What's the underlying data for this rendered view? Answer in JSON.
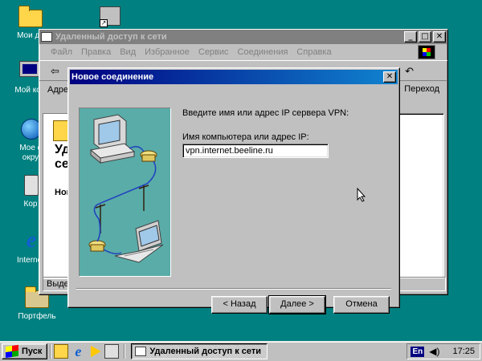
{
  "desktop": {
    "icons": [
      {
        "label": "Мои до",
        "icon": "folder-icon"
      },
      {
        "label": "Мой ком",
        "icon": "computer-icon"
      },
      {
        "label": "Мое с",
        "label2": "окру",
        "icon": "network-icon"
      },
      {
        "label": "Кор",
        "icon": "recycle-bin-icon"
      },
      {
        "label": "Internet",
        "icon": "internet-explorer-icon"
      },
      {
        "label": "Портфель",
        "icon": "briefcase-icon"
      }
    ]
  },
  "explorer": {
    "title": "Удаленный доступ к сети",
    "menu": [
      "Файл",
      "Правка",
      "Вид",
      "Избранное",
      "Сервис",
      "Соединения",
      "Справка"
    ],
    "address_label": "Адре",
    "go_label": "Переход",
    "heading_line1": "Уд",
    "heading_line2": "сет",
    "sub_label": "Нов",
    "status_text": "Выдел"
  },
  "dialog": {
    "title": "Новое соединение",
    "prompt": "Введите имя или адрес IP сервера VPN:",
    "field_label": "Имя компьютера или адрес IP:",
    "field_value": "vpn.internet.beeline.ru",
    "buttons": {
      "back": "< Назад",
      "next": "Далее >",
      "cancel": "Отмена"
    }
  },
  "taskbar": {
    "start_label": "Пуск",
    "task_label": "Удаленный доступ к сети",
    "language": "En",
    "clock": "17:25"
  },
  "colors": {
    "desktop": "#008080",
    "active_title": "#000080",
    "inactive_title": "#808080",
    "art_background": "#5aaca8"
  }
}
